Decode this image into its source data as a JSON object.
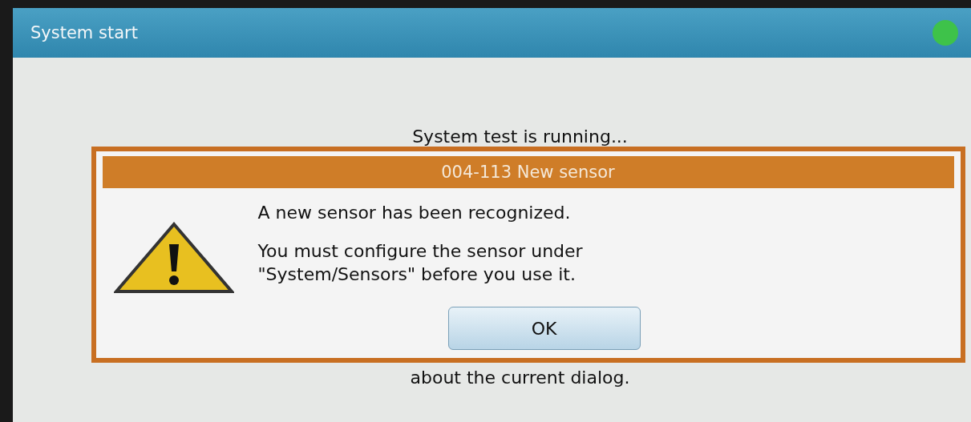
{
  "window": {
    "title": "System start"
  },
  "status_text": "System test is running...",
  "dialog": {
    "title": "004-113 New sensor",
    "message": "A new sensor has been recognized.",
    "instruction": "You must configure the sensor under\n\"System/Sensors\" before you use it.",
    "buttons": [
      "OK"
    ]
  },
  "footer_text": "about the current dialog."
}
